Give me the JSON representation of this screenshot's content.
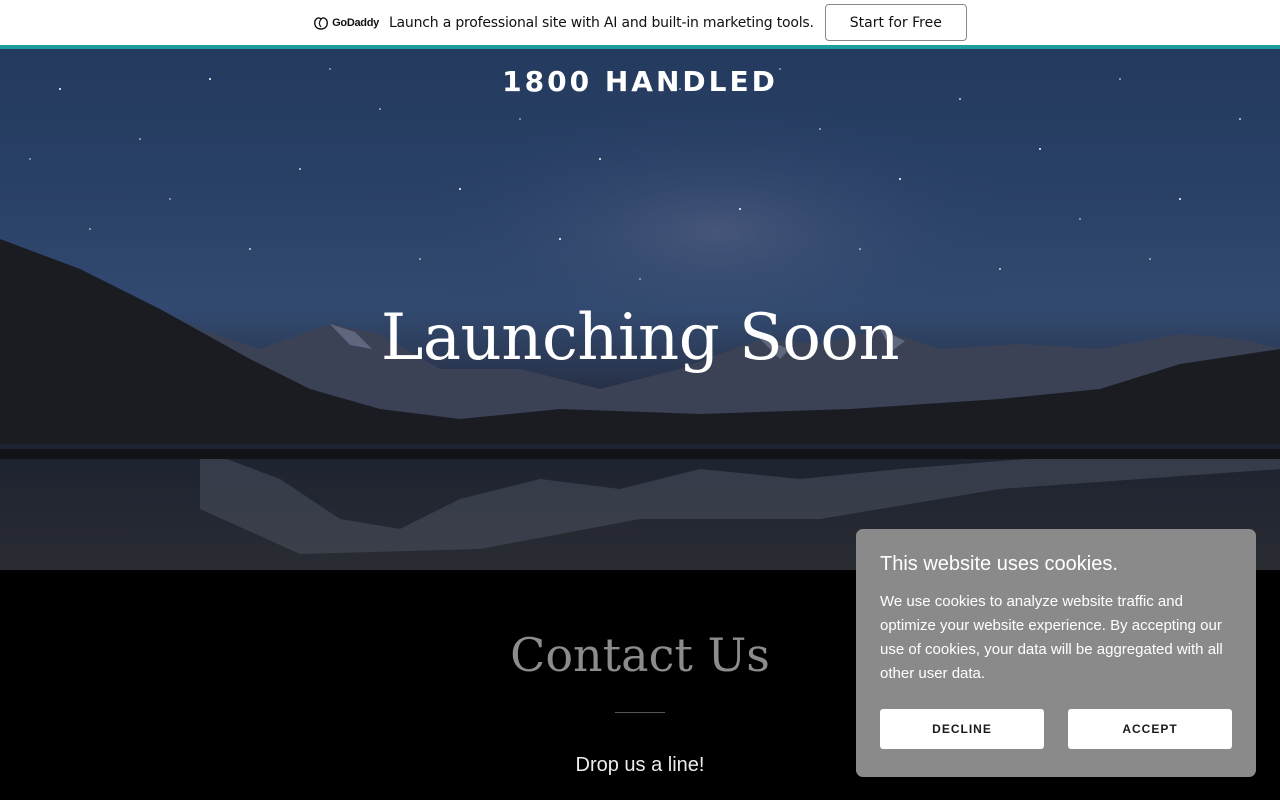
{
  "promo": {
    "logo_text": "GoDaddy",
    "message": "Launch a professional site with AI and built-in marketing tools.",
    "cta_label": "Start for Free",
    "accent_color": "#1b9ea0"
  },
  "hero": {
    "brand": "1800 HANDLED",
    "headline": "Launching Soon"
  },
  "contact": {
    "title": "Contact Us",
    "subtitle": "Drop us a line!"
  },
  "cookie_banner": {
    "title": "This website uses cookies.",
    "body": "We use cookies to analyze website traffic and optimize your website experience. By accepting our use of cookies, your data will be aggregated with all other user data.",
    "decline_label": "DECLINE",
    "accept_label": "ACCEPT"
  }
}
